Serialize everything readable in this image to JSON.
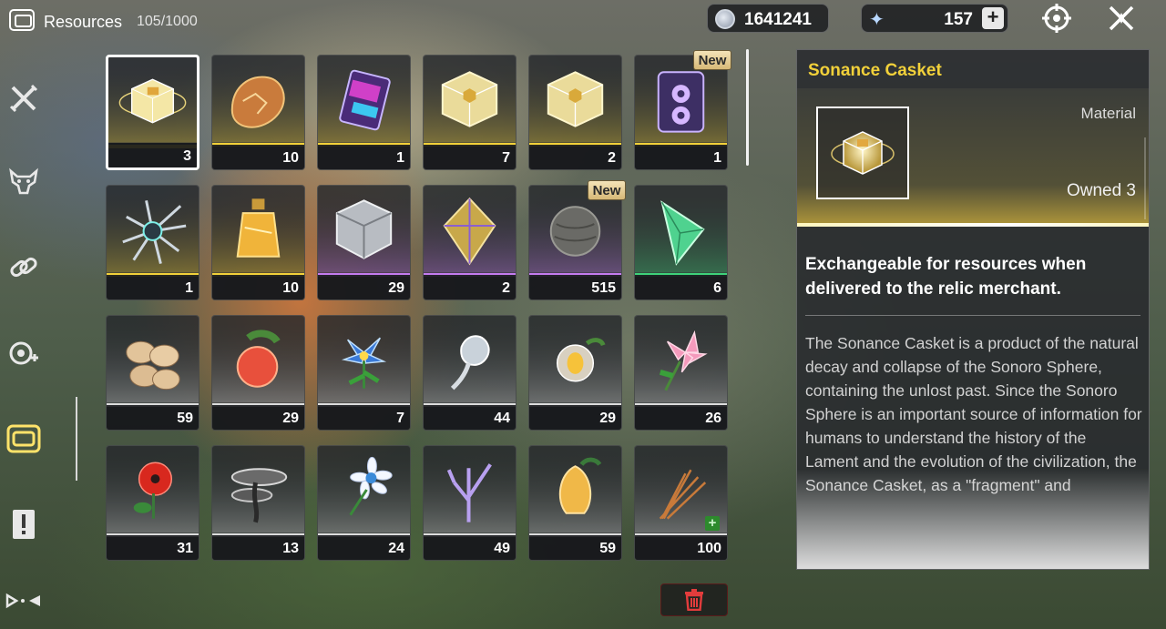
{
  "header": {
    "title": "Resources",
    "capacity": "105/1000",
    "icon": "resources-box-icon"
  },
  "currency": [
    {
      "name": "shell-credit",
      "icon": "shell-coin-icon",
      "value": "1641241"
    },
    {
      "name": "astrite",
      "icon": "astrite-star-icon",
      "value": "157",
      "add_label": "+"
    }
  ],
  "top_actions": [
    {
      "icon": "target-crosshair-icon"
    },
    {
      "icon": "close-x-icon"
    }
  ],
  "sidebar": [
    {
      "icon": "crossed-swords-icon",
      "label": "Weapons"
    },
    {
      "icon": "demon-mask-icon",
      "label": "Echoes"
    },
    {
      "icon": "chain-link-icon",
      "label": "Upgrade Materials"
    },
    {
      "icon": "gear-settings-icon",
      "label": "Development Materials"
    },
    {
      "icon": "resources-box-icon",
      "label": "Resources",
      "active": true
    },
    {
      "icon": "exclamation-card-icon",
      "label": "Quest Items"
    },
    {
      "icon": "special-items-icon",
      "label": "Special Items"
    }
  ],
  "items": [
    {
      "count": "3",
      "rarity": "gold",
      "selected": true,
      "art": "sonance-casket"
    },
    {
      "count": "10",
      "rarity": "gold",
      "art": "orange-shell"
    },
    {
      "count": "1",
      "rarity": "gold",
      "art": "purple-card"
    },
    {
      "count": "7",
      "rarity": "gold",
      "art": "gold-cube"
    },
    {
      "count": "2",
      "rarity": "gold",
      "art": "gold-cube"
    },
    {
      "count": "1",
      "rarity": "gold",
      "new": "New",
      "art": "purple-tape"
    },
    {
      "count": "1",
      "rarity": "gold",
      "art": "spiky-urchin"
    },
    {
      "count": "10",
      "rarity": "gold",
      "art": "amber-bottle"
    },
    {
      "count": "29",
      "rarity": "purple",
      "art": "silver-cube"
    },
    {
      "count": "2",
      "rarity": "purple",
      "art": "gold-prism"
    },
    {
      "count": "515",
      "rarity": "purple",
      "new": "New",
      "art": "gray-ball"
    },
    {
      "count": "6",
      "rarity": "green",
      "art": "green-pyramid"
    },
    {
      "count": "59",
      "rarity": "white",
      "art": "beans"
    },
    {
      "count": "29",
      "rarity": "white",
      "art": "red-fruit"
    },
    {
      "count": "7",
      "rarity": "white",
      "art": "blue-flower"
    },
    {
      "count": "44",
      "rarity": "white",
      "art": "silver-plant"
    },
    {
      "count": "29",
      "rarity": "white",
      "art": "gold-bulb"
    },
    {
      "count": "26",
      "rarity": "white",
      "art": "pink-lily"
    },
    {
      "count": "31",
      "rarity": "white",
      "art": "red-poppy"
    },
    {
      "count": "13",
      "rarity": "white",
      "art": "dark-mushroom"
    },
    {
      "count": "24",
      "rarity": "white",
      "art": "white-daisy"
    },
    {
      "count": "49",
      "rarity": "white",
      "art": "purple-coral"
    },
    {
      "count": "59",
      "rarity": "white",
      "art": "golden-cone"
    },
    {
      "count": "100",
      "rarity": "white",
      "plus": "+",
      "art": "dry-grass"
    }
  ],
  "detail": {
    "title": "Sonance Casket",
    "type": "Material",
    "owned": "Owned 3",
    "description": "Exchangeable for resources when delivered to the relic merchant.",
    "lore": "The Sonance Casket is a product of the natural decay and collapse of the Sonoro Sphere, containing the unlost past. Since the Sonoro Sphere is an important source of information for humans to understand the history of the Lament and the evolution of the civilization, the Sonance Casket, as a \"fragment\" and"
  },
  "trash": {
    "icon": "trash-icon"
  },
  "colors": {
    "gold": "#f2d13a",
    "purple": "#c47bf0",
    "green": "#3ed27a",
    "white": "#dcdcdc",
    "accent": "#f2d13a"
  }
}
